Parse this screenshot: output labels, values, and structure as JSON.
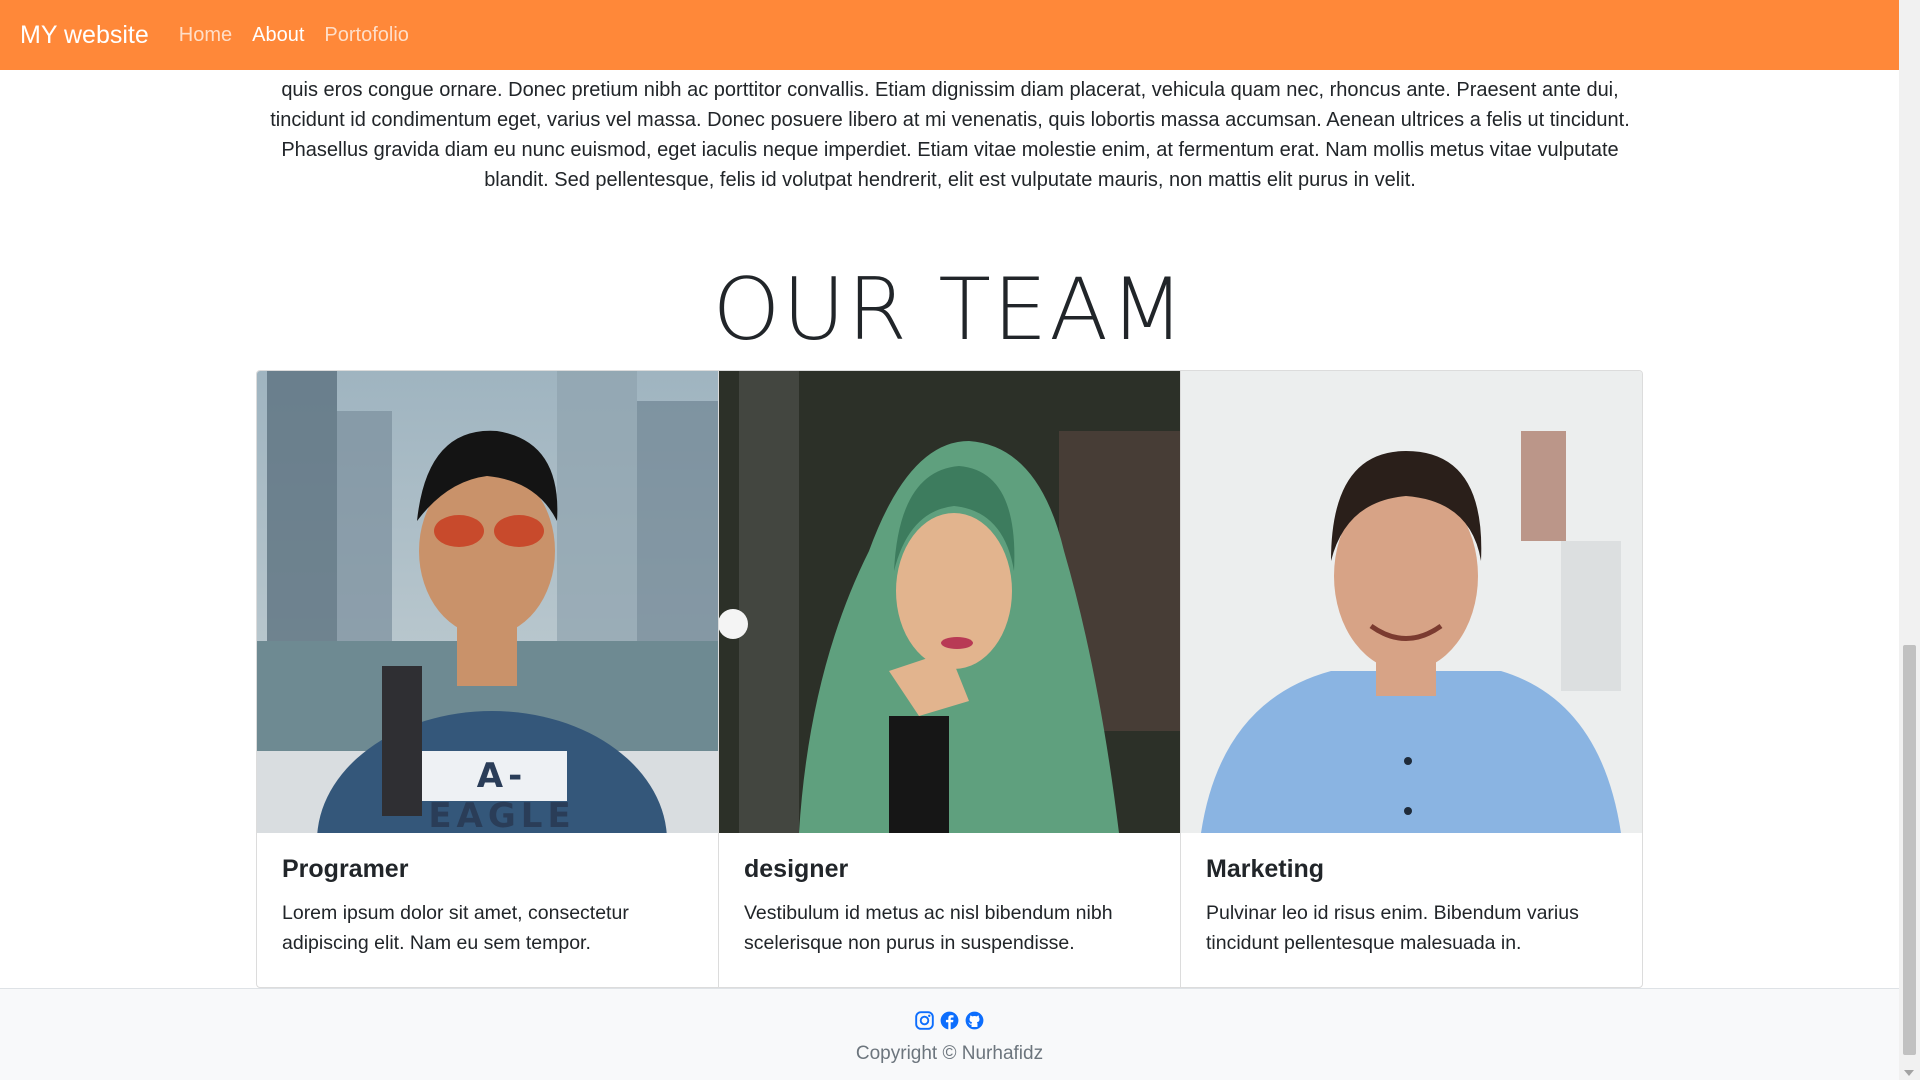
{
  "navbar": {
    "brand": "MY website",
    "links": [
      {
        "label": "Home"
      },
      {
        "label": "About"
      },
      {
        "label": "Portofolio"
      }
    ]
  },
  "intro": {
    "text": "quis eros congue ornare. Donec pretium nibh ac porttitor convallis. Etiam dignissim diam placerat, vehicula quam nec, rhoncus ante. Praesent ante dui, tincidunt id condimentum eget, varius vel massa. Donec posuere libero at mi venenatis, quis lobortis massa accumsan. Aenean ultrices a felis ut tincidunt. Phasellus gravida diam eu nunc euismod, eget iaculis neque imperdiet. Etiam vitae molestie enim, at fermentum erat. Nam mollis metus vitae vulputate blandit. Sed pellentesque, felis id volutpat hendrerit, elit est vulputate mauris, non mattis elit purus in velit."
  },
  "team": {
    "title": "OUR TEAM",
    "cards": [
      {
        "title": "Programer",
        "text": "Lorem ipsum dolor sit amet, consectetur adipiscing elit. Nam eu sem tempor.",
        "shirt_text": "A-EAGLE"
      },
      {
        "title": "designer",
        "text": "Vestibulum id metus ac nisl bibendum nibh scelerisque non purus in suspendisse."
      },
      {
        "title": "Marketing",
        "text": "Pulvinar leo id risus enim. Bibendum varius tincidunt pellentesque malesuada in."
      }
    ]
  },
  "footer": {
    "icons": [
      "instagram-icon",
      "facebook-icon",
      "github-icon"
    ],
    "copyright": "Copyright © Nurhafidz"
  },
  "colors": {
    "navbar": "#FF8839",
    "footer_icons": "#0D6EFD"
  }
}
